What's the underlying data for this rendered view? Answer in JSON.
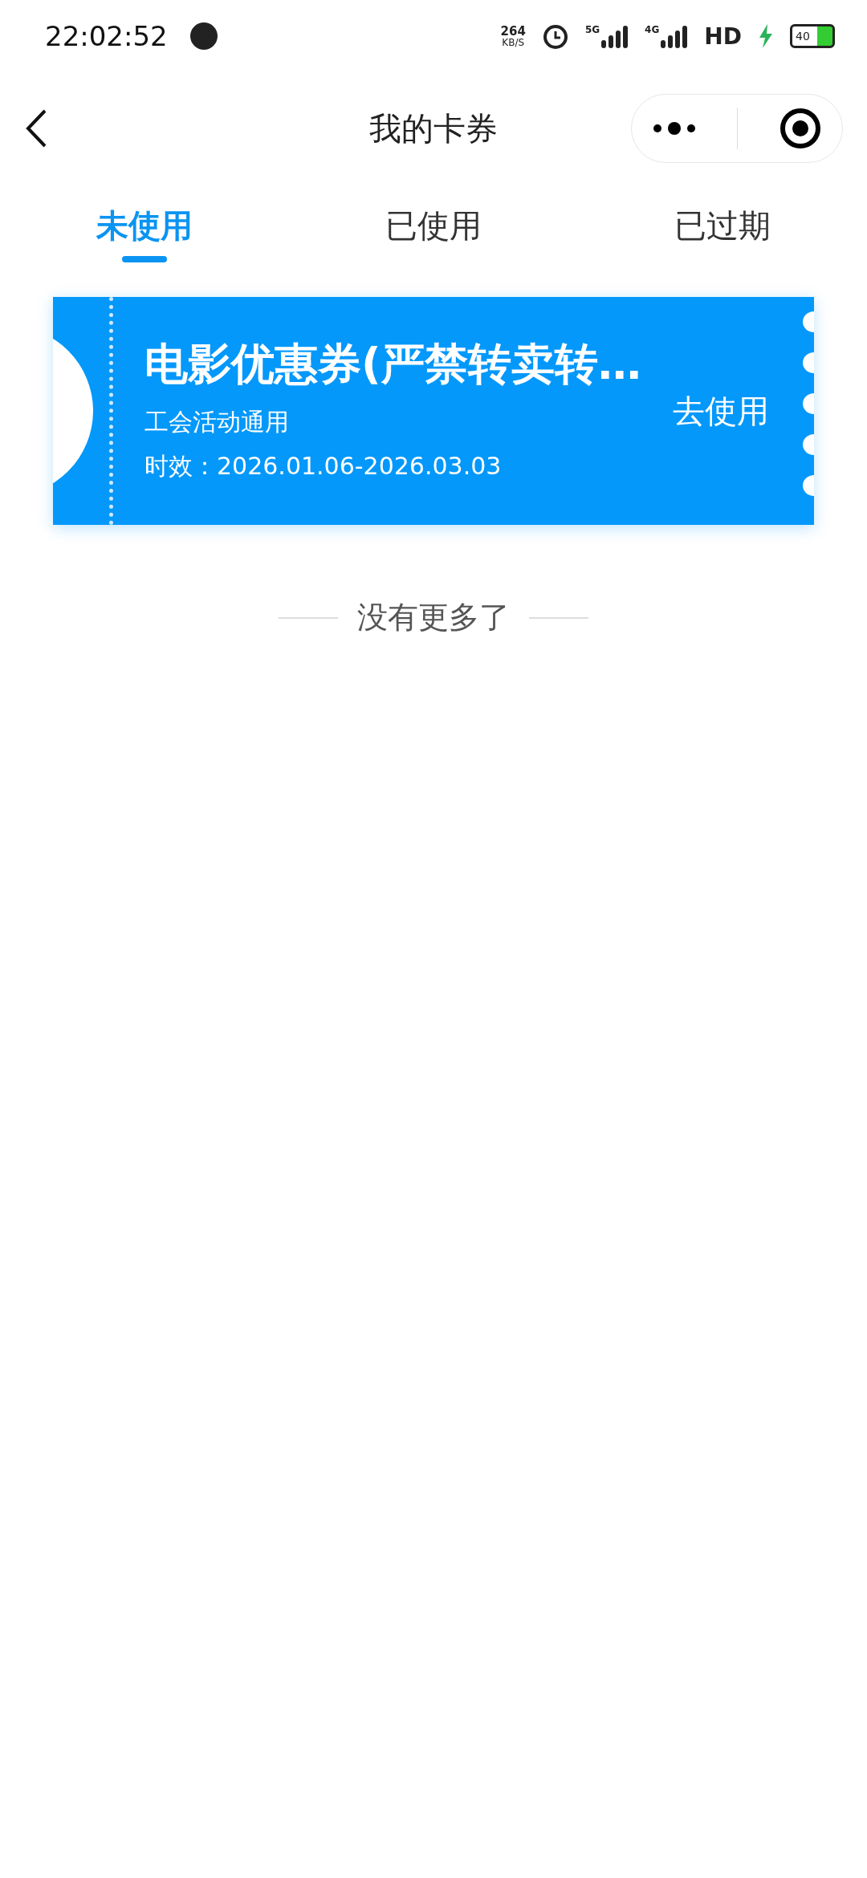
{
  "status_bar": {
    "time": "22:02:52",
    "net_speed": "264",
    "net_unit": "KB/S",
    "sig1": "5G",
    "sig2": "4G",
    "hd": "HD",
    "battery": "40"
  },
  "nav": {
    "title": "我的卡券"
  },
  "tabs": [
    {
      "label": "未使用",
      "selected": true
    },
    {
      "label": "已使用",
      "selected": false
    },
    {
      "label": "已过期",
      "selected": false
    }
  ],
  "coupons": [
    {
      "title": "电影优惠券(严禁转卖转…",
      "subtitle": "工会活动通用",
      "validity": "时效：2026.01.06-2026.03.03",
      "action": "去使用"
    }
  ],
  "footer": "没有更多了"
}
